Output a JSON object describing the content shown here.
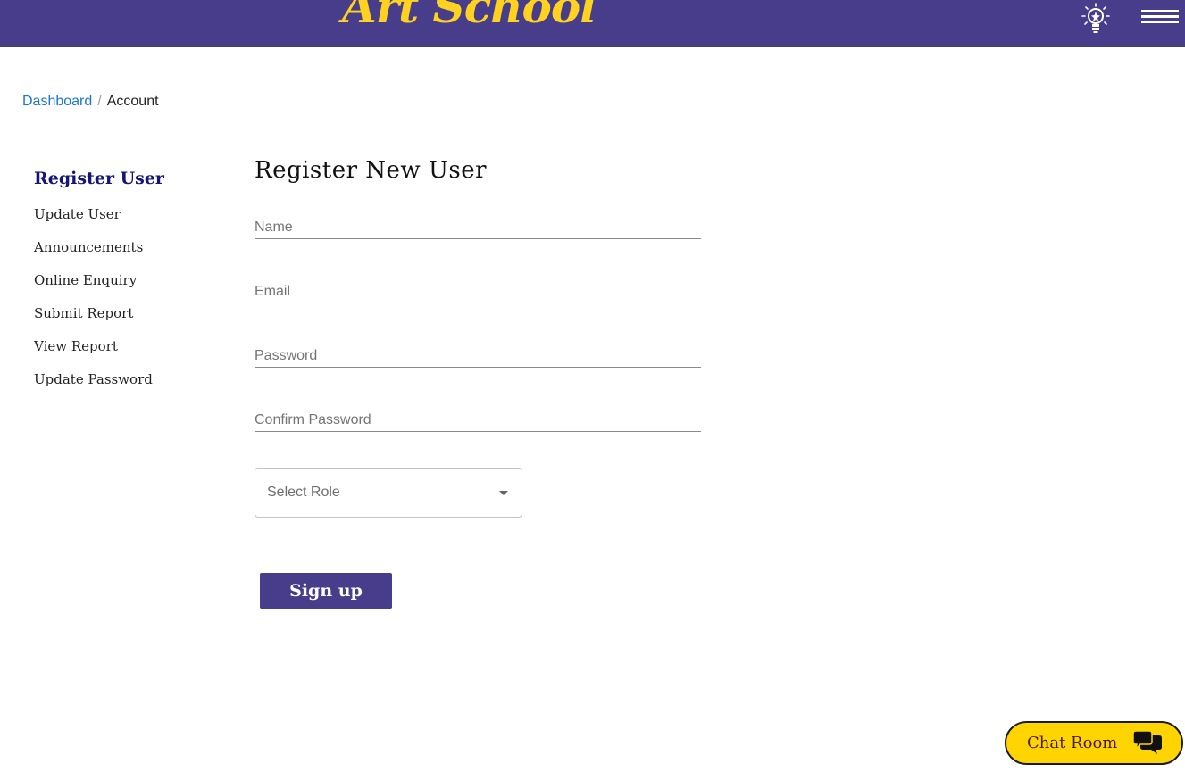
{
  "header": {
    "logo_text": "Art School",
    "idea_icon": "lightbulb-icon",
    "menu_icon": "hamburger-menu-icon",
    "background_color": "#483d8b",
    "logo_color": "#ffd21f"
  },
  "breadcrumb": {
    "items": [
      "Dashboard",
      "Account"
    ],
    "separator": "/"
  },
  "sidebar": {
    "items": [
      {
        "label": "Register User",
        "active": true
      },
      {
        "label": "Update User"
      },
      {
        "label": "Announcements"
      },
      {
        "label": "Online Enquiry"
      },
      {
        "label": "Submit Report"
      },
      {
        "label": "View Report"
      },
      {
        "label": "Update Password"
      }
    ],
    "active_color": "#14147a"
  },
  "form": {
    "title": "Register New User",
    "fields": [
      {
        "placeholder": "Name",
        "value": ""
      },
      {
        "placeholder": "Email",
        "value": ""
      },
      {
        "placeholder": "Password",
        "value": ""
      },
      {
        "placeholder": "Confirm Password",
        "value": ""
      }
    ],
    "role_select": {
      "value": "Select Role"
    },
    "submit_label": "Sign up",
    "button_color": "#483d8b"
  },
  "chat": {
    "label": "Chat Room",
    "icon": "chat-bubbles-icon",
    "background_color": "#ffd400"
  }
}
